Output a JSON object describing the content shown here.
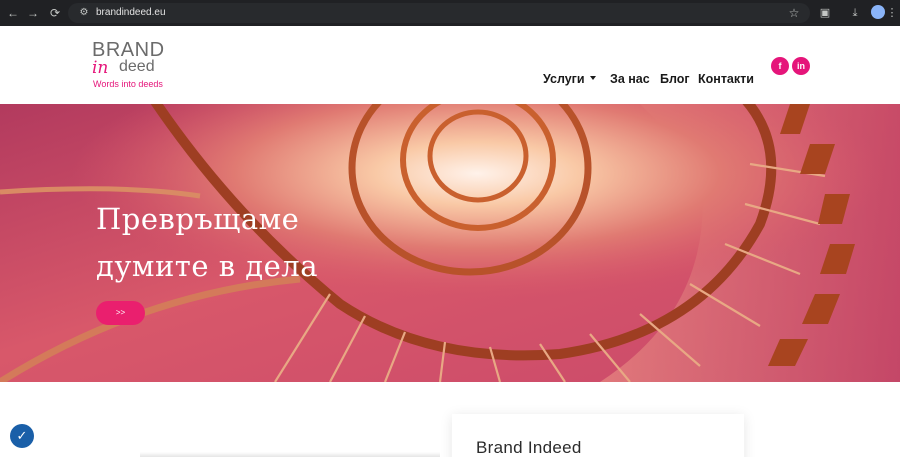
{
  "browser": {
    "url": "brandindeed.eu",
    "icons": {
      "back": "arrow-left-icon",
      "forward": "arrow-right-icon",
      "reload": "reload-icon",
      "site_settings": "tune-icon",
      "bookmark": "star-icon",
      "extensions": "puzzle-icon",
      "downloads": "download-icon",
      "menu": "kebab-menu-icon"
    }
  },
  "logo": {
    "brand": "BRAND",
    "in": "in",
    "deed": "deed",
    "tagline": "Words into deeds"
  },
  "nav": {
    "services": "Услуги",
    "about": "За нас",
    "blog": "Блог",
    "contacts": "Контакти"
  },
  "social": {
    "facebook": "f",
    "linkedin": "in"
  },
  "hero": {
    "line1": "Превръщаме",
    "line2": "думите в дела",
    "button": ">>"
  },
  "section": {
    "card_title": "Brand Indeed"
  },
  "consent": {
    "icon": "cookie-consent-icon"
  },
  "colors": {
    "accent": "#e5157a",
    "hero_button": "#ea1f6e",
    "hero_bg": "#c84a6e",
    "chrome_bg": "#202124"
  }
}
